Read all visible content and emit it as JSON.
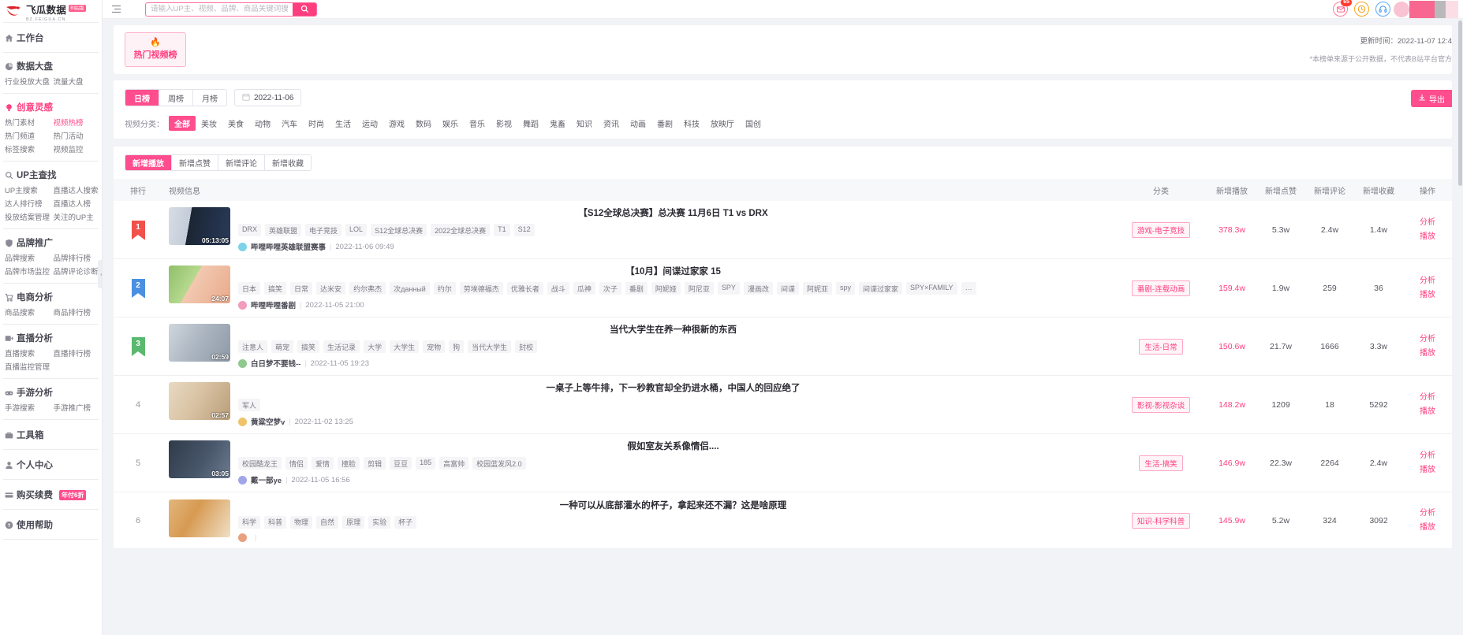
{
  "brand": {
    "name": "飞瓜数据",
    "badge": "B站版",
    "sub": "BZ.FEIGUA.CN",
    "logo_icon": "feigua-logo-icon"
  },
  "topbar": {
    "menu_icon": "hamburger-icon",
    "search": {
      "placeholder": "请输入UP主、视频、品牌、商品关键词搜索",
      "value": "",
      "icon": "search-icon"
    },
    "icons": [
      {
        "name": "mail-icon",
        "glyph": "✉",
        "badge": "65",
        "color": "#ff5c85"
      },
      {
        "name": "clock-icon",
        "glyph": "◔",
        "badge": "",
        "color": "#f5a623"
      },
      {
        "name": "headset-icon",
        "glyph": "☊",
        "badge": "",
        "color": "#4a9bf0"
      }
    ]
  },
  "sidebar": {
    "collapse_icon": "chevron-left-icon",
    "groups": [
      {
        "icon": "home-icon",
        "title": "工作台",
        "links": []
      },
      {
        "icon": "pie-chart-icon",
        "title": "数据大盘",
        "links": [
          "行业投放大盘",
          "流量大盘"
        ]
      },
      {
        "icon": "lightbulb-icon",
        "title": "创意灵感",
        "accent": true,
        "links": [
          "热门素材",
          "视频热榜",
          "热门频道",
          "热门活动",
          "标签搜索",
          "视频监控"
        ],
        "hot_link": "视频热榜"
      },
      {
        "icon": "search-icon",
        "title": "UP主查找",
        "links": [
          "UP主搜索",
          "直播达人搜索",
          "达人排行榜",
          "直播达人榜",
          "投放结案管理",
          "关注的UP主"
        ]
      },
      {
        "icon": "shield-icon",
        "title": "品牌推广",
        "links": [
          "品牌搜索",
          "品牌排行榜",
          "品牌市场监控",
          "品牌评论诊断"
        ]
      },
      {
        "icon": "cart-icon",
        "title": "电商分析",
        "links": [
          "商品搜索",
          "商品排行榜"
        ]
      },
      {
        "icon": "video-icon",
        "title": "直播分析",
        "links": [
          "直播搜索",
          "直播排行榜",
          "直播监控管理"
        ]
      },
      {
        "icon": "gamepad-icon",
        "title": "手游分析",
        "links": [
          "手游搜索",
          "手游推广榜"
        ]
      },
      {
        "icon": "toolbox-icon",
        "title": "工具箱",
        "links": []
      },
      {
        "icon": "user-icon",
        "title": "个人中心",
        "links": []
      },
      {
        "icon": "card-icon",
        "title": "购买续费",
        "badge": "年付6折",
        "links": []
      },
      {
        "icon": "question-icon",
        "title": "使用帮助",
        "links": []
      }
    ]
  },
  "banner": {
    "hot_tab_label": "热门视频榜",
    "hot_tab_icon": "flame-icon",
    "update_time": "更新时间：2022-11-07 12:4",
    "disclaimer": "*本榜单来源于公开数据，不代表B站平台官方"
  },
  "filters": {
    "period_tabs": [
      {
        "label": "日榜",
        "active": true
      },
      {
        "label": "周榜",
        "active": false
      },
      {
        "label": "月榜",
        "active": false
      }
    ],
    "date_value": "2022-11-06",
    "date_icon": "calendar-icon",
    "category_label": "视频分类：",
    "categories": [
      {
        "label": "全部",
        "active": true
      },
      {
        "label": "美妆",
        "active": false
      },
      {
        "label": "美食",
        "active": false
      },
      {
        "label": "动物",
        "active": false
      },
      {
        "label": "汽车",
        "active": false
      },
      {
        "label": "时尚",
        "active": false
      },
      {
        "label": "生活",
        "active": false
      },
      {
        "label": "运动",
        "active": false
      },
      {
        "label": "游戏",
        "active": false
      },
      {
        "label": "数码",
        "active": false
      },
      {
        "label": "娱乐",
        "active": false
      },
      {
        "label": "音乐",
        "active": false
      },
      {
        "label": "影视",
        "active": false
      },
      {
        "label": "舞蹈",
        "active": false
      },
      {
        "label": "鬼畜",
        "active": false
      },
      {
        "label": "知识",
        "active": false
      },
      {
        "label": "资讯",
        "active": false
      },
      {
        "label": "动画",
        "active": false
      },
      {
        "label": "番剧",
        "active": false
      },
      {
        "label": "科技",
        "active": false
      },
      {
        "label": "放映厅",
        "active": false
      },
      {
        "label": "国创",
        "active": false
      }
    ],
    "export_label": "导出",
    "export_icon": "download-icon"
  },
  "sort_tabs": [
    {
      "label": "新增播放",
      "active": true
    },
    {
      "label": "新增点赞",
      "active": false
    },
    {
      "label": "新增评论",
      "active": false
    },
    {
      "label": "新增收藏",
      "active": false
    }
  ],
  "table": {
    "columns": {
      "rank": "排行",
      "info": "视频信息",
      "category": "分类",
      "plays": "新增播放",
      "likes": "新增点赞",
      "comments": "新增评论",
      "favorites": "新增收藏",
      "action": "操作"
    },
    "action_labels": {
      "analyze": "分析",
      "play": "播放"
    },
    "rows": [
      {
        "rank": "1",
        "rank_style": "r1",
        "duration": "05:13:05",
        "title": "【S12全球总决赛】总决赛 11月6日 T1 vs DRX",
        "tags": [
          "DRX",
          "英雄联盟",
          "电子竞技",
          "LOL",
          "S12全球总决赛",
          "2022全球总决赛",
          "T1",
          "S12"
        ],
        "author": "哔哩哔哩英雄联盟赛事",
        "published": "2022-11-06 09:49",
        "category": "游戏-电子竞技",
        "plays": "378.3w",
        "likes": "5.3w",
        "comments": "2.4w",
        "favorites": "1.4w"
      },
      {
        "rank": "2",
        "rank_style": "r2",
        "duration": "24:07",
        "title": "【10月】间谍过家家 15",
        "tags": [
          "日本",
          "搞笑",
          "日常",
          "达米安",
          "约尔弗杰",
          "次данный",
          "约尔",
          "劳埃德福杰",
          "优雅长者",
          "战斗",
          "瓜神",
          "次子",
          "番剧",
          "阿妮娅",
          "阿尼亚",
          "SPY",
          "漫画改",
          "间谍",
          "阿妮亚",
          "spy",
          "间谍过家家",
          "SPY×FAMILY",
          "…"
        ],
        "author": "哔哩哔哩番剧",
        "published": "2022-11-05 21:00",
        "category": "番剧-连载动画",
        "plays": "159.4w",
        "likes": "1.9w",
        "comments": "259",
        "favorites": "36"
      },
      {
        "rank": "3",
        "rank_style": "r3",
        "duration": "02:59",
        "title": "当代大学生在养一种很新的东西",
        "tags": [
          "注意人",
          "萌宠",
          "搞笑",
          "生活记录",
          "大学",
          "大学生",
          "宠物",
          "狗",
          "当代大学生",
          "封校"
        ],
        "author": "白日梦不要钱--",
        "published": "2022-11-05 19:23",
        "category": "生活-日常",
        "plays": "150.6w",
        "likes": "21.7w",
        "comments": "1666",
        "favorites": "3.3w"
      },
      {
        "rank": "4",
        "rank_style": "plain",
        "duration": "02:57",
        "title": "一桌子上等牛排，下一秒教官却全扔进水桶，中国人的回应绝了",
        "tags": [
          "军人"
        ],
        "author": "黄粱空梦v",
        "published": "2022-11-02 13:25",
        "category": "影视-影视杂谈",
        "plays": "148.2w",
        "likes": "1209",
        "comments": "18",
        "favorites": "5292"
      },
      {
        "rank": "5",
        "rank_style": "plain",
        "duration": "03:05",
        "title": "假如室友关系像情侣....",
        "tags": [
          "校园酷龙王",
          "情侣",
          "爱情",
          "撞脸",
          "剪辑",
          "豆豆",
          "185",
          "高富帅",
          "校园蓝发风2.0"
        ],
        "author": "戴一部ye",
        "published": "2022-11-05 16:56",
        "category": "生活-搞笑",
        "plays": "146.9w",
        "likes": "22.3w",
        "comments": "2264",
        "favorites": "2.4w"
      },
      {
        "rank": "6",
        "rank_style": "plain",
        "duration": "",
        "title": "一种可以从底部灌水的杯子，拿起来还不漏？这是啥原理",
        "tags": [
          "科学",
          "科普",
          "物理",
          "自然",
          "原理",
          "实验",
          "杯子"
        ],
        "author": "",
        "published": "",
        "category": "知识-科学科普",
        "plays": "145.9w",
        "likes": "5.2w",
        "comments": "324",
        "favorites": "3092"
      }
    ]
  }
}
